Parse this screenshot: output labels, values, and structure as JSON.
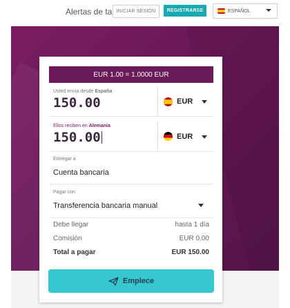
{
  "header": {
    "rate_alerts": "Alertas de tasa",
    "login_label": "INICIAR SESIÓN",
    "register_label": "REGISTRARSE",
    "language": "ESPAÑOL"
  },
  "card": {
    "exchange_rate": "EUR 1.00 = 1.0000 EUR",
    "send": {
      "label_prefix": "Usted envía desde ",
      "country": "España",
      "amount": "150.00",
      "currency": "EUR"
    },
    "receive": {
      "label_prefix": "Ellos reciben en ",
      "country": "Alemania",
      "amount": "150.00",
      "currency": "EUR"
    },
    "deliver": {
      "label": "Entregar a",
      "value": "Cuenta bancaria"
    },
    "payment": {
      "label": "Pagar con",
      "value": "Transferencia bancaria manual"
    },
    "summary": [
      {
        "label": "Debe llegar",
        "value": "hasta 1 día"
      },
      {
        "label": "Comisión",
        "value": "EUR 0.00"
      },
      {
        "label": "Total a pagar",
        "value": "EUR 150.00"
      }
    ],
    "start_label": "Emplece"
  },
  "colors": {
    "brand_purple": "#6b1a5a",
    "accent_teal": "#16a9b1",
    "button_cyan": "#35c8ce"
  },
  "icons": [
    "spain-flag-icon",
    "germany-flag-icon",
    "chevron-down-icon",
    "paper-plane-icon"
  ]
}
